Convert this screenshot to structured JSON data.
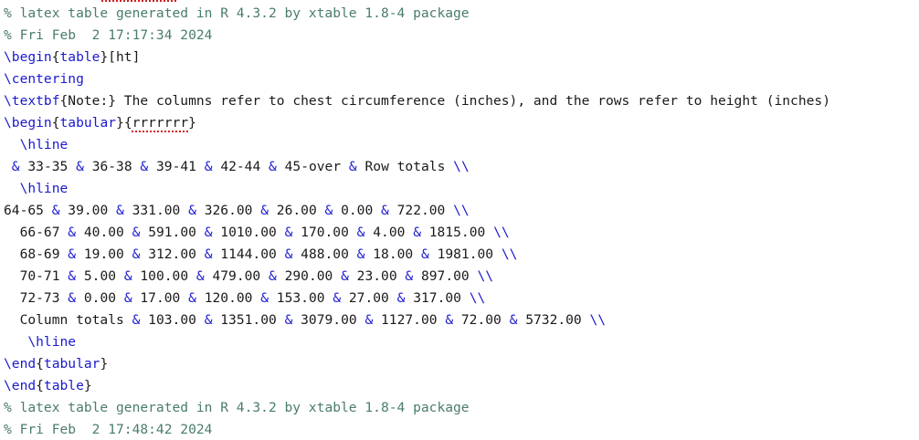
{
  "editor": {
    "lines": [
      {
        "segments": [
          {
            "t": "% latex table generated in R 4.3.2 by xtable 1.8-4 package",
            "k": "comment"
          }
        ]
      },
      {
        "segments": [
          {
            "t": "% Fri Feb  2 17:17:34 2024",
            "k": "comment"
          }
        ]
      },
      {
        "segments": [
          {
            "t": "\\begin",
            "k": "cmd"
          },
          {
            "t": "{",
            "k": "text"
          },
          {
            "t": "table",
            "k": "cmd"
          },
          {
            "t": "}[ht]",
            "k": "text"
          }
        ]
      },
      {
        "segments": [
          {
            "t": "\\centering",
            "k": "cmd"
          }
        ]
      },
      {
        "segments": [
          {
            "t": "\\textbf",
            "k": "cmd"
          },
          {
            "t": "{Note:} The columns refer to chest circumference (inches), and the rows refer to height (inches)",
            "k": "text"
          }
        ]
      },
      {
        "segments": [
          {
            "t": "\\begin",
            "k": "cmd"
          },
          {
            "t": "{",
            "k": "text"
          },
          {
            "t": "tabular",
            "k": "cmd"
          },
          {
            "t": "}{",
            "k": "text"
          },
          {
            "t": "rrrrrrr",
            "k": "spell"
          },
          {
            "t": "}",
            "k": "text"
          }
        ]
      },
      {
        "segments": [
          {
            "t": "  \\hline",
            "k": "cmd"
          }
        ]
      },
      {
        "segments": [
          {
            "t": " ",
            "k": "text"
          },
          {
            "t": "&",
            "k": "sym"
          },
          {
            "t": " 33-35 ",
            "k": "text"
          },
          {
            "t": "&",
            "k": "sym"
          },
          {
            "t": " 36-38 ",
            "k": "text"
          },
          {
            "t": "&",
            "k": "sym"
          },
          {
            "t": " 39-41 ",
            "k": "text"
          },
          {
            "t": "&",
            "k": "sym"
          },
          {
            "t": " 42-44 ",
            "k": "text"
          },
          {
            "t": "&",
            "k": "sym"
          },
          {
            "t": " 45-over ",
            "k": "text"
          },
          {
            "t": "&",
            "k": "sym"
          },
          {
            "t": " Row totals ",
            "k": "text"
          },
          {
            "t": "\\\\",
            "k": "sym"
          }
        ]
      },
      {
        "segments": [
          {
            "t": "  \\hline",
            "k": "cmd"
          }
        ]
      },
      {
        "segments": [
          {
            "t": "64-65 ",
            "k": "text"
          },
          {
            "t": "&",
            "k": "sym"
          },
          {
            "t": " 39.00 ",
            "k": "text"
          },
          {
            "t": "&",
            "k": "sym"
          },
          {
            "t": " 331.00 ",
            "k": "text"
          },
          {
            "t": "&",
            "k": "sym"
          },
          {
            "t": " 326.00 ",
            "k": "text"
          },
          {
            "t": "&",
            "k": "sym"
          },
          {
            "t": " 26.00 ",
            "k": "text"
          },
          {
            "t": "&",
            "k": "sym"
          },
          {
            "t": " 0.00 ",
            "k": "text"
          },
          {
            "t": "&",
            "k": "sym"
          },
          {
            "t": " 722.00 ",
            "k": "text"
          },
          {
            "t": "\\\\",
            "k": "sym"
          }
        ]
      },
      {
        "segments": [
          {
            "t": "  66-67 ",
            "k": "text"
          },
          {
            "t": "&",
            "k": "sym"
          },
          {
            "t": " 40.00 ",
            "k": "text"
          },
          {
            "t": "&",
            "k": "sym"
          },
          {
            "t": " 591.00 ",
            "k": "text"
          },
          {
            "t": "&",
            "k": "sym"
          },
          {
            "t": " 1010.00 ",
            "k": "text"
          },
          {
            "t": "&",
            "k": "sym"
          },
          {
            "t": " 170.00 ",
            "k": "text"
          },
          {
            "t": "&",
            "k": "sym"
          },
          {
            "t": " 4.00 ",
            "k": "text"
          },
          {
            "t": "&",
            "k": "sym"
          },
          {
            "t": " 1815.00 ",
            "k": "text"
          },
          {
            "t": "\\\\",
            "k": "sym"
          }
        ]
      },
      {
        "segments": [
          {
            "t": "  68-69 ",
            "k": "text"
          },
          {
            "t": "&",
            "k": "sym"
          },
          {
            "t": " 19.00 ",
            "k": "text"
          },
          {
            "t": "&",
            "k": "sym"
          },
          {
            "t": " 312.00 ",
            "k": "text"
          },
          {
            "t": "&",
            "k": "sym"
          },
          {
            "t": " 1144.00 ",
            "k": "text"
          },
          {
            "t": "&",
            "k": "sym"
          },
          {
            "t": " 488.00 ",
            "k": "text"
          },
          {
            "t": "&",
            "k": "sym"
          },
          {
            "t": " 18.00 ",
            "k": "text"
          },
          {
            "t": "&",
            "k": "sym"
          },
          {
            "t": " 1981.00 ",
            "k": "text"
          },
          {
            "t": "\\\\",
            "k": "sym"
          }
        ]
      },
      {
        "segments": [
          {
            "t": "  70-71 ",
            "k": "text"
          },
          {
            "t": "&",
            "k": "sym"
          },
          {
            "t": " 5.00 ",
            "k": "text"
          },
          {
            "t": "&",
            "k": "sym"
          },
          {
            "t": " 100.00 ",
            "k": "text"
          },
          {
            "t": "&",
            "k": "sym"
          },
          {
            "t": " 479.00 ",
            "k": "text"
          },
          {
            "t": "&",
            "k": "sym"
          },
          {
            "t": " 290.00 ",
            "k": "text"
          },
          {
            "t": "&",
            "k": "sym"
          },
          {
            "t": " 23.00 ",
            "k": "text"
          },
          {
            "t": "&",
            "k": "sym"
          },
          {
            "t": " 897.00 ",
            "k": "text"
          },
          {
            "t": "\\\\",
            "k": "sym"
          }
        ]
      },
      {
        "segments": [
          {
            "t": "  72-73 ",
            "k": "text"
          },
          {
            "t": "&",
            "k": "sym"
          },
          {
            "t": " 0.00 ",
            "k": "text"
          },
          {
            "t": "&",
            "k": "sym"
          },
          {
            "t": " 17.00 ",
            "k": "text"
          },
          {
            "t": "&",
            "k": "sym"
          },
          {
            "t": " 120.00 ",
            "k": "text"
          },
          {
            "t": "&",
            "k": "sym"
          },
          {
            "t": " 153.00 ",
            "k": "text"
          },
          {
            "t": "&",
            "k": "sym"
          },
          {
            "t": " 27.00 ",
            "k": "text"
          },
          {
            "t": "&",
            "k": "sym"
          },
          {
            "t": " 317.00 ",
            "k": "text"
          },
          {
            "t": "\\\\",
            "k": "sym"
          }
        ]
      },
      {
        "segments": [
          {
            "t": "  Column totals ",
            "k": "text"
          },
          {
            "t": "&",
            "k": "sym"
          },
          {
            "t": " 103.00 ",
            "k": "text"
          },
          {
            "t": "&",
            "k": "sym"
          },
          {
            "t": " 1351.00 ",
            "k": "text"
          },
          {
            "t": "&",
            "k": "sym"
          },
          {
            "t": " 3079.00 ",
            "k": "text"
          },
          {
            "t": "&",
            "k": "sym"
          },
          {
            "t": " 1127.00 ",
            "k": "text"
          },
          {
            "t": "&",
            "k": "sym"
          },
          {
            "t": " 72.00 ",
            "k": "text"
          },
          {
            "t": "&",
            "k": "sym"
          },
          {
            "t": " 5732.00 ",
            "k": "text"
          },
          {
            "t": "\\\\",
            "k": "sym"
          }
        ]
      },
      {
        "segments": [
          {
            "t": "   \\hline",
            "k": "cmd"
          }
        ]
      },
      {
        "segments": [
          {
            "t": "\\end",
            "k": "cmd"
          },
          {
            "t": "{",
            "k": "text"
          },
          {
            "t": "tabular",
            "k": "cmd"
          },
          {
            "t": "}",
            "k": "text"
          }
        ]
      },
      {
        "segments": [
          {
            "t": "\\end",
            "k": "cmd"
          },
          {
            "t": "{",
            "k": "text"
          },
          {
            "t": "table",
            "k": "cmd"
          },
          {
            "t": "}",
            "k": "text"
          }
        ]
      },
      {
        "segments": [
          {
            "t": "% latex table generated in R 4.3.2 by xtable 1.8-4 package",
            "k": "comment"
          }
        ]
      },
      {
        "segments": [
          {
            "t": "% Fri Feb  2 17:48:42 2024",
            "k": "comment"
          }
        ]
      }
    ]
  },
  "colors": {
    "comment": "#4a7c6e",
    "command": "#1a1ad0",
    "text": "#1a1a1a",
    "spellcheck": "#d02020",
    "background": "#ffffff"
  }
}
